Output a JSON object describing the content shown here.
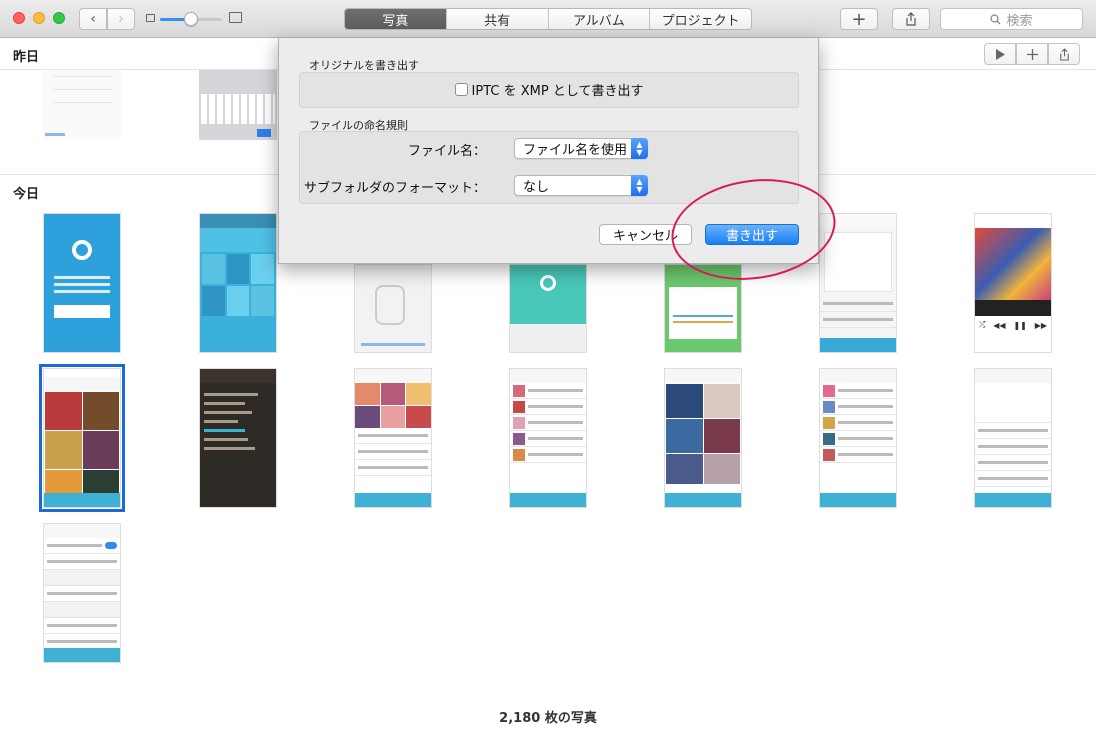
{
  "toolbar": {
    "back_label": "‹",
    "forward_label": "›",
    "zoom_level": 0.5,
    "tabs": [
      {
        "label": "写真",
        "active": true
      },
      {
        "label": "共有",
        "active": false
      },
      {
        "label": "アルバム",
        "active": false
      },
      {
        "label": "プロジェクト",
        "active": false
      }
    ],
    "add_label": "+",
    "search_placeholder": "検索"
  },
  "sections": {
    "yesterday": "昨日",
    "today": "今日"
  },
  "photo_count": "2,180 枚の写真",
  "dialog": {
    "group1_label": "オリジナルを書き出す",
    "iptc_checkbox_label": "IPTC を XMP として書き出す",
    "iptc_checked": false,
    "group2_label": "ファイルの命名規則",
    "filename_label": "ファイル名：",
    "filename_value": "ファイル名を使用",
    "subfolder_label": "サブフォルダのフォーマット：",
    "subfolder_value": "なし",
    "cancel_label": "キャンセル",
    "export_label": "書き出す"
  },
  "colors": {
    "accent": "#1a7cf3",
    "player_bar": "#3fb1d5",
    "annotation": "#d9185f",
    "selected_outline": "#1a6ad8"
  }
}
